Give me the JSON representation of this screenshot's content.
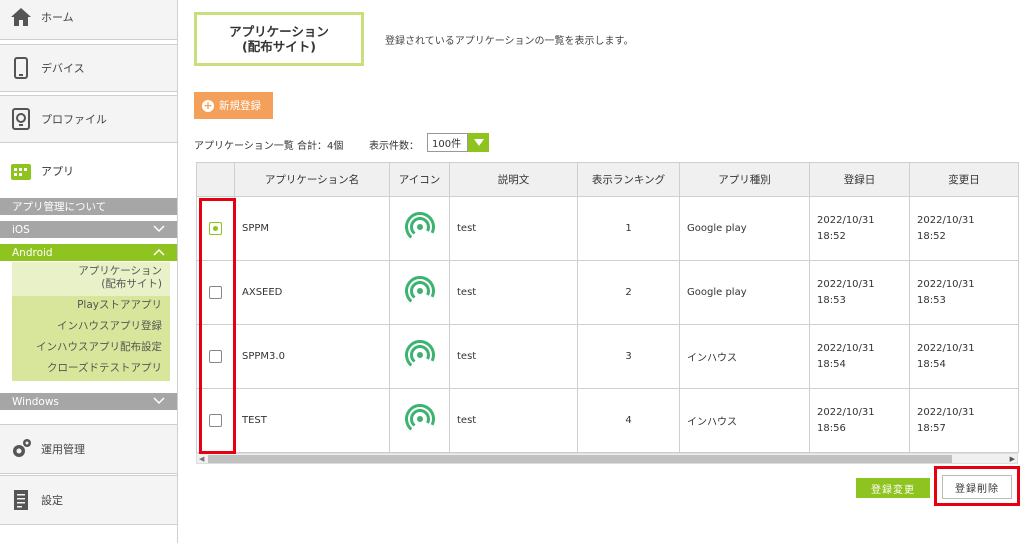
{
  "colors": {
    "accent_green": "#8fc31f",
    "accent_orange": "#f5a05a",
    "highlight_red": "#e60012",
    "title_border": "#c9de7d"
  },
  "sidebar": {
    "home": {
      "label": "ホーム",
      "icon": "home-icon"
    },
    "device": {
      "label": "デバイス",
      "icon": "smartphone-icon"
    },
    "profile": {
      "label": "プロファイル",
      "icon": "profile-icon"
    },
    "app": {
      "label": "アプリ",
      "icon": "app-icon"
    },
    "about": {
      "label": "アプリ管理について"
    },
    "ios": {
      "label": "iOS"
    },
    "android": {
      "label": "Android",
      "items": [
        {
          "label_line1": "アプリケーション",
          "label_line2": "(配布サイト)"
        },
        {
          "label": "Playストアアプリ"
        },
        {
          "label": "インハウスアプリ登録"
        },
        {
          "label": "インハウスアプリ配布設定"
        },
        {
          "label": "クローズドテストアプリ"
        }
      ]
    },
    "windows": {
      "label": "Windows"
    },
    "operation": {
      "label": "運用管理",
      "icon": "gear-icon"
    },
    "settings": {
      "label": "設定",
      "icon": "document-icon"
    }
  },
  "header": {
    "title_line1": "アプリケーション",
    "title_line2": "(配布サイト)",
    "description": "登録されているアプリケーションの一覧を表示します。"
  },
  "toolbar": {
    "new_label": "新規登録",
    "list_summary": "アプリケーション一覧 合計：4個",
    "count_label": "表示件数：",
    "count_value": "100件"
  },
  "table": {
    "columns": [
      "",
      "アプリケーション名",
      "アイコン",
      "説明文",
      "表示ランキング",
      "アプリ種別",
      "登録日",
      "変更日"
    ],
    "rows": [
      {
        "checked": true,
        "name": "SPPM",
        "description": "test",
        "ranking": "1",
        "type": "Google play",
        "created_date": "2022/10/31",
        "created_time": "18:52",
        "updated_date": "2022/10/31",
        "updated_time": "18:52"
      },
      {
        "checked": false,
        "name": "AXSEED",
        "description": "test",
        "ranking": "2",
        "type": "Google play",
        "created_date": "2022/10/31",
        "created_time": "18:53",
        "updated_date": "2022/10/31",
        "updated_time": "18:53"
      },
      {
        "checked": false,
        "name": "SPPM3.0",
        "description": "test",
        "ranking": "3",
        "type": "インハウス",
        "created_date": "2022/10/31",
        "created_time": "18:54",
        "updated_date": "2022/10/31",
        "updated_time": "18:54"
      },
      {
        "checked": false,
        "name": "TEST",
        "description": "test",
        "ranking": "4",
        "type": "インハウス",
        "created_date": "2022/10/31",
        "created_time": "18:56",
        "updated_date": "2022/10/31",
        "updated_time": "18:57"
      }
    ]
  },
  "actions": {
    "change_label": "登録変更",
    "delete_label": "登録削除"
  }
}
